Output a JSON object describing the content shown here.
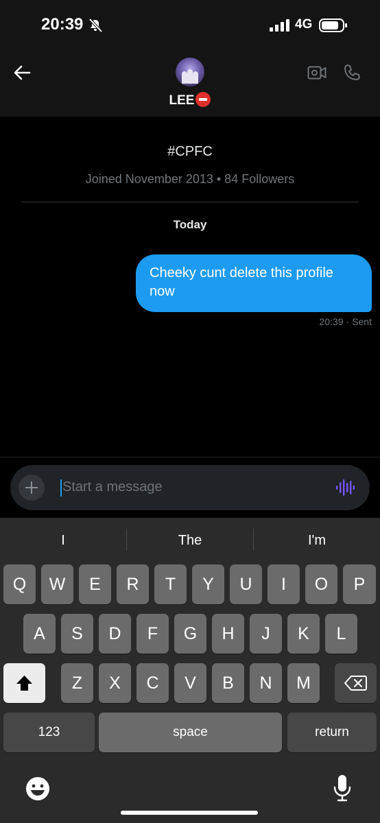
{
  "status_bar": {
    "time": "20:39",
    "network": "4G"
  },
  "header": {
    "contact_name": "LEE",
    "icons": [
      "back-arrow-icon",
      "avatar",
      "stop-sign-emoji",
      "video-call-icon",
      "phone-icon"
    ]
  },
  "profile": {
    "bio": "#CPFC",
    "meta": "Joined November 2013 • 84 Followers"
  },
  "conversation": {
    "date_label": "Today",
    "messages": [
      {
        "text": "Cheeky cunt delete this profile now",
        "time": "20:39",
        "status": "Sent",
        "outgoing": true
      }
    ]
  },
  "composer": {
    "placeholder": "Start a message"
  },
  "keyboard": {
    "suggestions": [
      "I",
      "The",
      "I'm"
    ],
    "row1": [
      "Q",
      "W",
      "E",
      "R",
      "T",
      "Y",
      "U",
      "I",
      "O",
      "P"
    ],
    "row2": [
      "A",
      "S",
      "D",
      "F",
      "G",
      "H",
      "J",
      "K",
      "L"
    ],
    "row3": [
      "Z",
      "X",
      "C",
      "V",
      "B",
      "N",
      "M"
    ],
    "numbers_label": "123",
    "space_label": "space",
    "return_label": "return"
  },
  "colors": {
    "accent": "#1d9bf0",
    "voice": "#7856ff",
    "background": "#000000"
  }
}
